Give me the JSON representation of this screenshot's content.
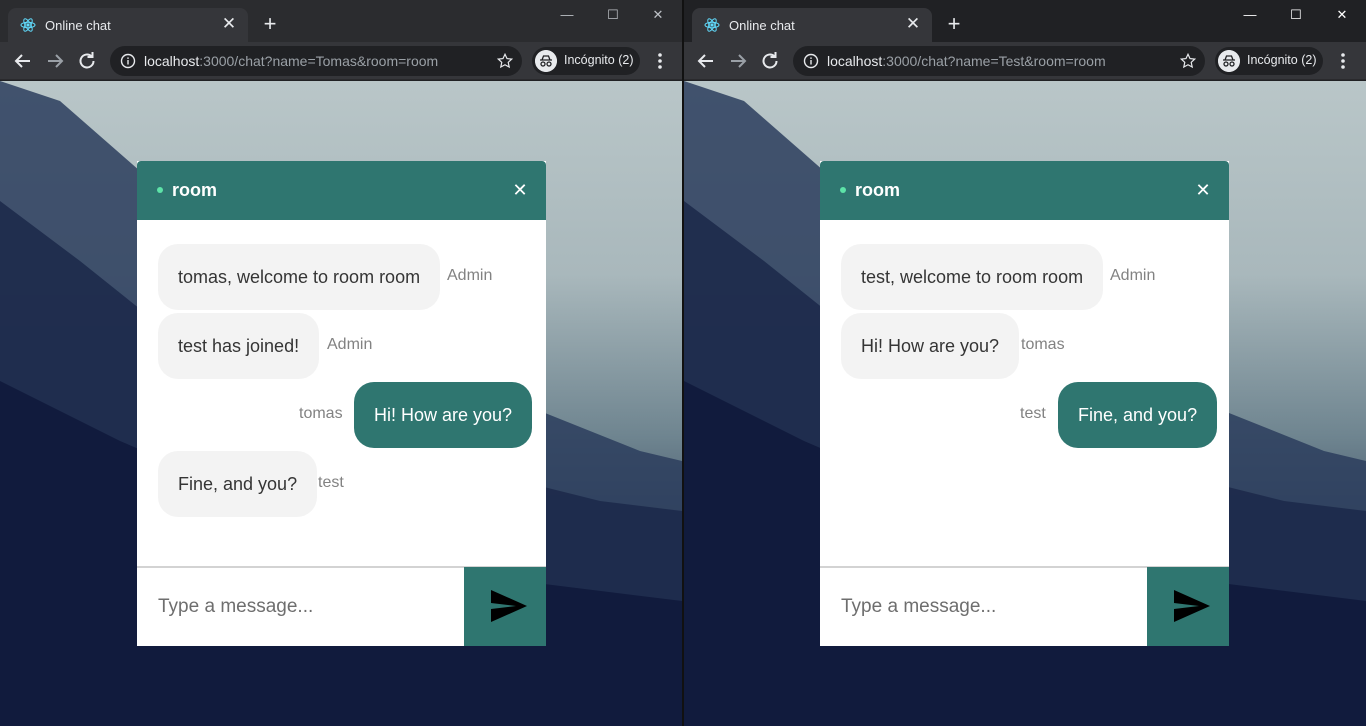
{
  "windows": [
    {
      "tab": {
        "title": "Online chat",
        "close": "✕"
      },
      "new_tab": "+",
      "controls": {
        "minimize": "—",
        "maximize": "☐",
        "close": "✕"
      },
      "url": {
        "host": "localhost",
        "rest": ":3000/chat?name=Tomas&room=room"
      },
      "incognito_label": "Incógnito (2)",
      "chat": {
        "room": "room",
        "close": "✕",
        "messages": [
          {
            "text": "tomas, welcome to room room",
            "sender": "Admin",
            "own": false
          },
          {
            "text": "test has joined!",
            "sender": "Admin",
            "own": false
          },
          {
            "text": "Hi! How are you?",
            "sender": "tomas",
            "own": true
          },
          {
            "text": "Fine, and you?",
            "sender": "test",
            "own": false
          }
        ],
        "input_placeholder": "Type a message...",
        "input_value": ""
      }
    },
    {
      "tab": {
        "title": "Online chat",
        "close": "✕"
      },
      "new_tab": "+",
      "controls": {
        "minimize": "—",
        "maximize": "☐",
        "close": "✕"
      },
      "url": {
        "host": "localhost",
        "rest": ":3000/chat?name=Test&room=room"
      },
      "incognito_label": "Incógnito (2)",
      "chat": {
        "room": "room",
        "close": "✕",
        "messages": [
          {
            "text": "test, welcome to room room",
            "sender": "Admin",
            "own": false
          },
          {
            "text": "Hi! How are you?",
            "sender": "tomas",
            "own": false
          },
          {
            "text": "Fine, and you?",
            "sender": "test",
            "own": true
          }
        ],
        "input_placeholder": "Type a message...",
        "input_value": ""
      }
    }
  ],
  "colors": {
    "accent": "#2f7670",
    "online_dot": "#5de3a8",
    "bubble_in": "#f3f3f3",
    "browser_dark": "#202124",
    "toolbar": "#35363a"
  },
  "icons": [
    "react-favicon-icon",
    "back-icon",
    "forward-icon",
    "reload-icon",
    "info-icon",
    "star-icon",
    "incognito-icon",
    "menu-icon",
    "send-icon"
  ]
}
